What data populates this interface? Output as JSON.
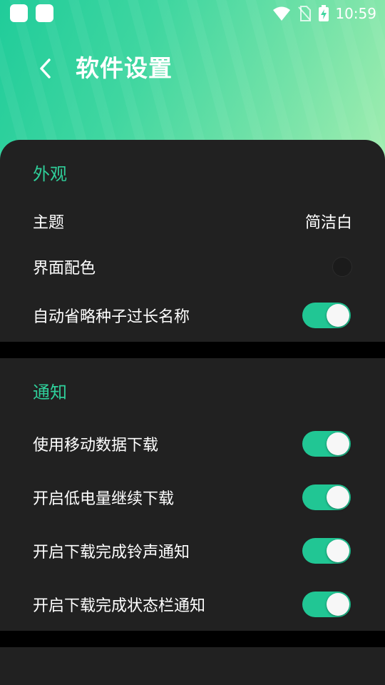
{
  "header": {
    "title": "软件设置",
    "status_time": "10:59"
  },
  "appearance": {
    "section_title": "外观",
    "theme_label": "主题",
    "theme_value": "简洁白",
    "color_label": "界面配色",
    "omit_long_names_label": "自动省略种子过长名称",
    "omit_long_names_on": true
  },
  "notifications": {
    "section_title": "通知",
    "items": [
      {
        "label": "使用移动数据下载",
        "on": true
      },
      {
        "label": "开启低电量继续下载",
        "on": true
      },
      {
        "label": "开启下载完成铃声通知",
        "on": true
      },
      {
        "label": "开启下载完成状态栏通知",
        "on": true
      }
    ]
  },
  "colors": {
    "accent": "#2fcf9a",
    "toggle_on": "#21c694",
    "card_bg": "#212121",
    "header_gradient_start": "#20cc9a",
    "header_gradient_end": "#a4eeb0"
  }
}
